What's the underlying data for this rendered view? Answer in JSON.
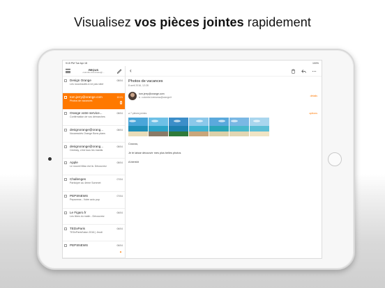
{
  "headline": {
    "regular_1": "Visualisez ",
    "bold": "vos pièces jointes",
    "regular_2": " rapidement"
  },
  "statusbar": {
    "left": "9:15 PM   Tue Apr 18",
    "right": "100%"
  },
  "sidebar": {
    "folder_title": "REÇUS",
    "folder_subtitle": "colombe.lorenceau@..."
  },
  "mails": [
    {
      "from": "Design Orange",
      "preview": "Les nouveautés à ne pas rater",
      "date": "08/04",
      "selected": false
    },
    {
      "from": "tom.jerry@orange.com",
      "preview": "Photos de vacances",
      "date": "12:21",
      "selected": true
    },
    {
      "from": "Orange votre service...",
      "preview": "Confirmation de vos démarches",
      "date": "08/04",
      "selected": false
    },
    {
      "from": "designorange@orang...",
      "preview": "Nouveautés Orange Bons plans",
      "date": "08/04",
      "selected": false
    },
    {
      "from": "designorange@orang...",
      "preview": "Cinéday, c'est tous les mardis",
      "date": "08/04",
      "selected": false
    },
    {
      "from": "Apple",
      "preview": "Le nouvel iMac est là. Découvrez",
      "date": "08/04",
      "selected": false
    },
    {
      "from": "Challenges",
      "preview": "Participer au 4ème Sommet",
      "date": "07/04",
      "selected": false
    },
    {
      "from": "PEPSNEWS",
      "preview": "Pepsnews - Votre actu pop",
      "date": "07/04",
      "selected": false
    },
    {
      "from": "Le Figaro.fr",
      "preview": "Les titres du matin - Découvrez",
      "date": "06/04",
      "selected": false
    },
    {
      "from": "TEDxParis",
      "preview": "TEDxParisSalon 2016 | Jeudi",
      "date": "06/04",
      "selected": false
    },
    {
      "from": "PEPSNEWS",
      "preview": "",
      "date": "06/04",
      "selected": false
    }
  ],
  "message": {
    "subject": "Photos de vacances",
    "date": "8 avril 2016, 12:28",
    "sender_email": "tom.jerry@orange.com",
    "recipient": "à : colombe.lorenceau@orange.fr",
    "details_label": "détails",
    "attachments_label": "7 pièces jointes",
    "options_label": "options",
    "body_greeting": "Coucou,",
    "body_text": "Je te laisse découvrir mes plus belles photos",
    "body_signoff": "A bientôt"
  },
  "thumbnails": [
    {
      "name": "beach-rocks-photo",
      "sky": "#4aa6d9",
      "sea": "#1e8fb8",
      "ground": "#e9dcb8"
    },
    {
      "name": "rocks-lagoon-photo",
      "sky": "#6ec0e6",
      "sea": "#2aa3c7",
      "ground": "#8a7a66"
    },
    {
      "name": "island-photo",
      "sky": "#3c8ec9",
      "sea": "#1c7fb0",
      "ground": "#2f7a3a"
    },
    {
      "name": "overwater-bungalow-photo",
      "sky": "#8bc8ea",
      "sea": "#3fb3d1",
      "ground": "#c9a67a"
    },
    {
      "name": "tropical-beach-photo",
      "sky": "#5aa9dc",
      "sea": "#29a6b8",
      "ground": "#dcd0a8"
    },
    {
      "name": "lagoon-photo",
      "sky": "#7ab8e4",
      "sea": "#48b9cc",
      "ground": "#e2d6b2"
    },
    {
      "name": "hammock-photo",
      "sky": "#a9d6ee",
      "sea": "#5cbfd6",
      "ground": "#f0e4c4"
    }
  ],
  "colors": {
    "accent": "#ff7900"
  }
}
